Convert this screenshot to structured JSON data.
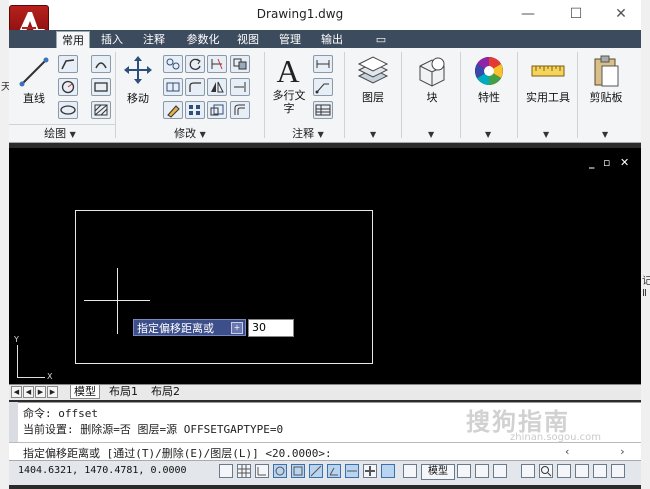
{
  "window": {
    "title": "Drawing1.dwg",
    "app_button": "A",
    "minimize": "—",
    "maximize": "☐",
    "close": "✕"
  },
  "desktop_edge": {
    "left_char": "天",
    "right_chars": [
      "记",
      "Ⅱ"
    ]
  },
  "ribbon": {
    "tabs": [
      "常用",
      "插入",
      "注释",
      "参数化",
      "视图",
      "管理",
      "输出",
      "▭"
    ],
    "active_tab": "常用",
    "panels": {
      "draw": {
        "title": "绘图",
        "line_label": "直线"
      },
      "modify": {
        "title": "修改",
        "move_label": "移动"
      },
      "annotation": {
        "title": "注释",
        "mtext_label": "多行文字"
      },
      "layers": {
        "label": "图层"
      },
      "block": {
        "label": "块"
      },
      "properties": {
        "label": "特性"
      },
      "utilities": {
        "label": "实用工具"
      },
      "clipboard": {
        "label": "剪贴板"
      }
    }
  },
  "canvas": {
    "controls": [
      "_",
      "▫",
      "✕"
    ],
    "ucs": {
      "x": "X",
      "y": "Y"
    },
    "dynamic_prompt": {
      "label": "指定偏移距离或",
      "options_icon": "+",
      "value": "30"
    }
  },
  "layout_tabs": [
    "模型",
    "布局1",
    "布局2"
  ],
  "command": {
    "history": [
      "命令:  offset",
      "当前设置: 删除源=否  图层=源  OFFSETGAPTYPE=0"
    ],
    "current": "指定偏移距离或 [通过(T)/删除(E)/图层(L)] <20.0000>:"
  },
  "status": {
    "coords": "1404.6321, 1470.4781, 0.0000",
    "model_label": "模型"
  },
  "watermark": {
    "main": "搜狗指南",
    "sub": "zhinan.sogou.com"
  }
}
